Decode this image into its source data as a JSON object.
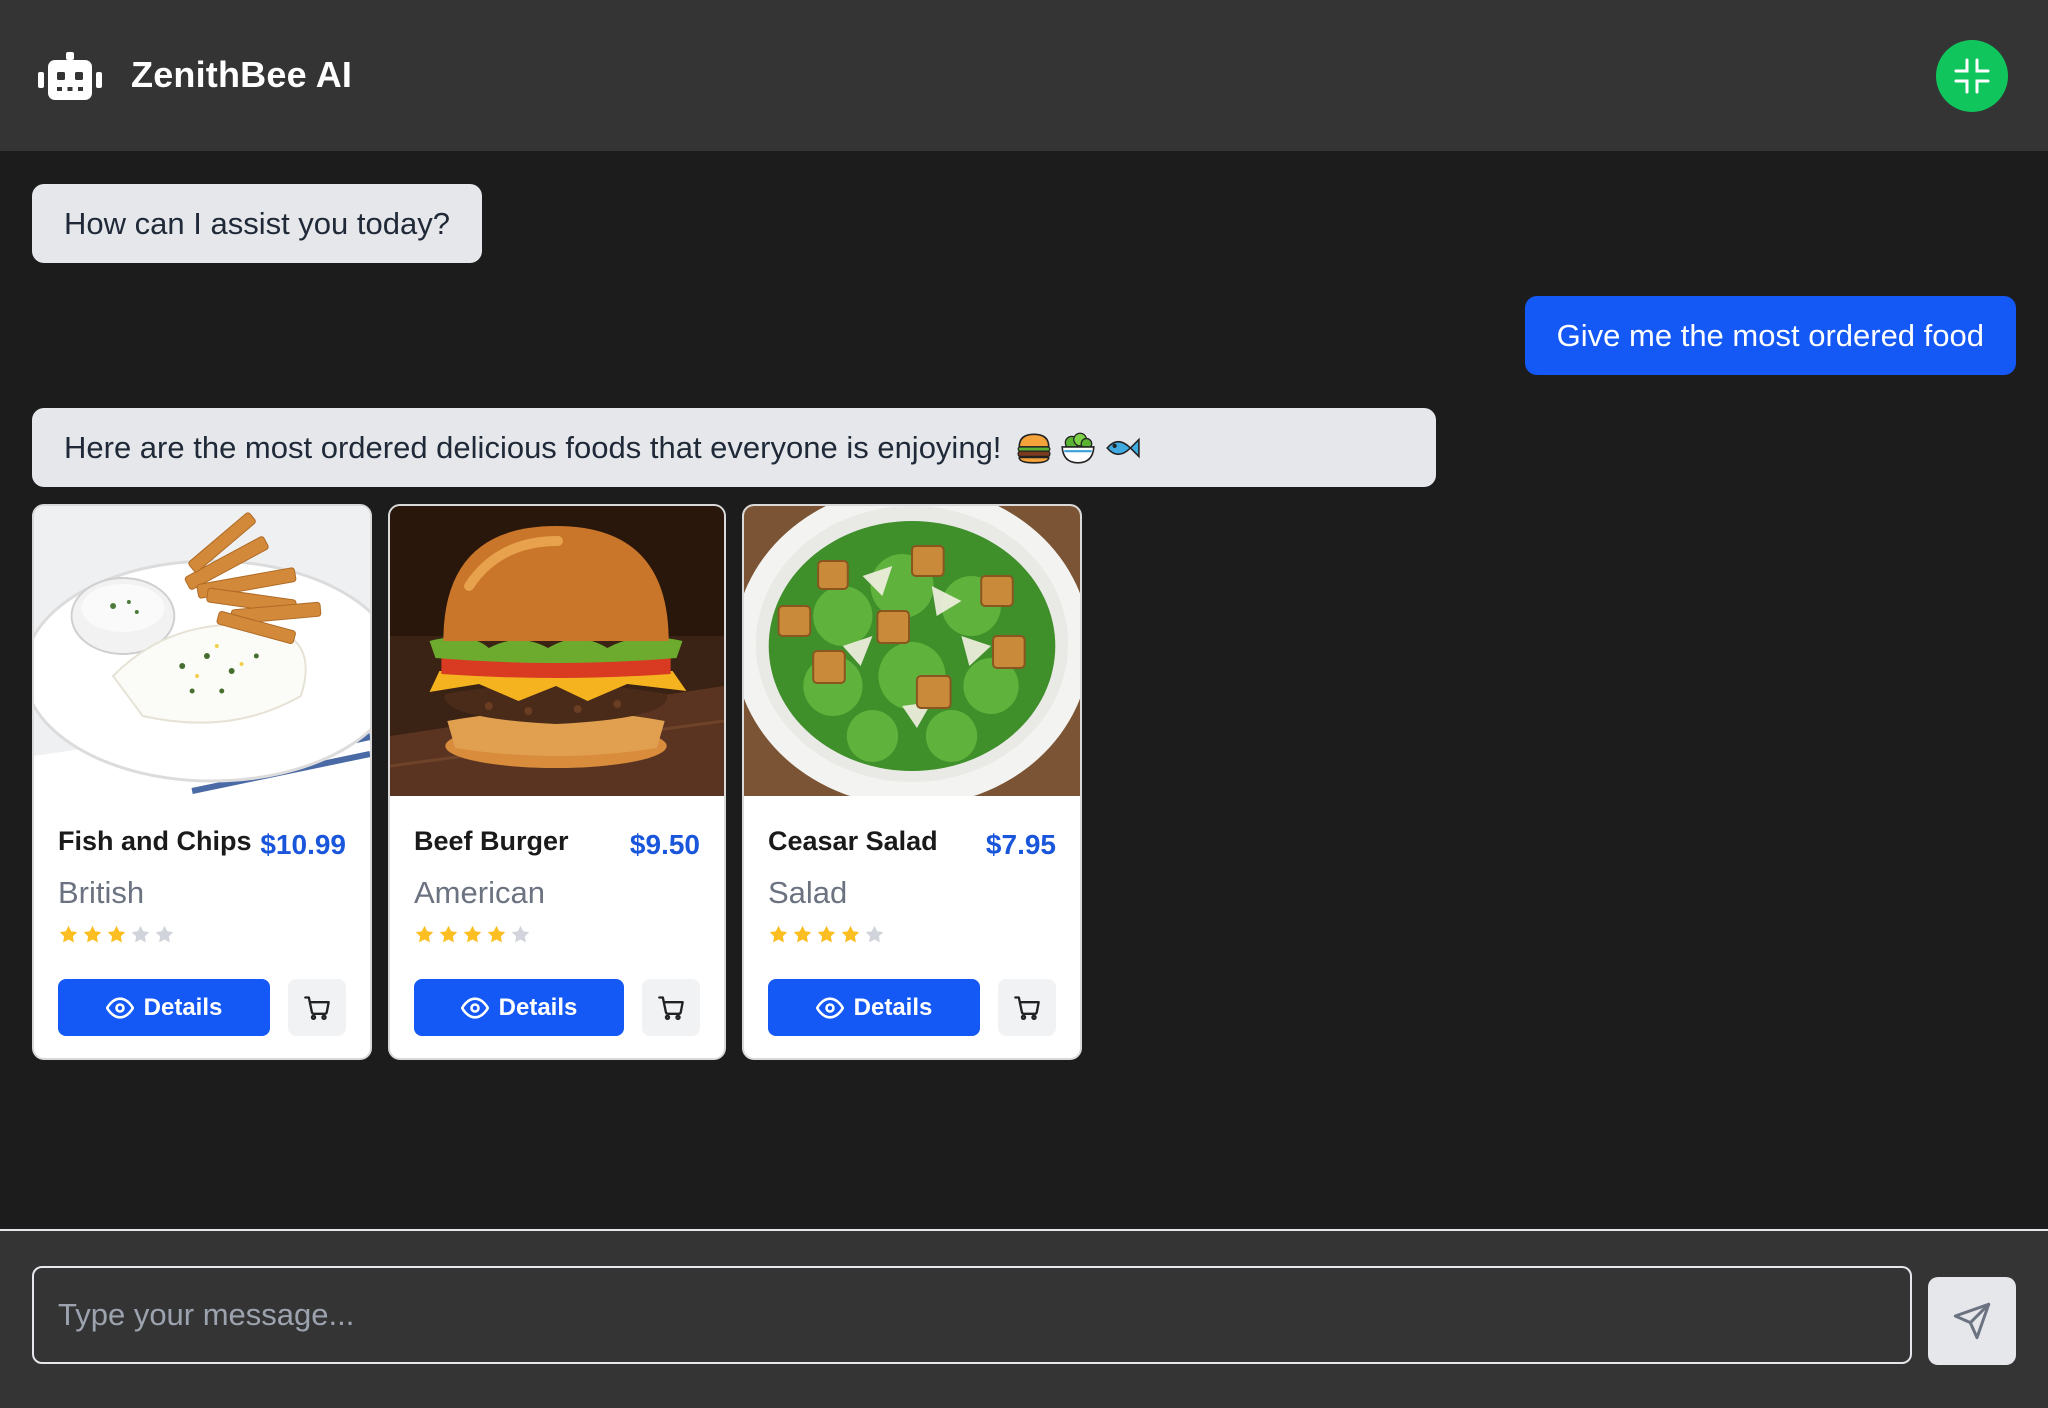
{
  "header": {
    "title": "ZenithBee AI",
    "icons": {
      "logo": "robot-icon",
      "minimize": "minimize-icon"
    },
    "minimize_color": "#10c55c"
  },
  "messages": [
    {
      "role": "bot",
      "text": "How can I assist you today?"
    },
    {
      "role": "user",
      "text": "Give me the most ordered food"
    },
    {
      "role": "bot",
      "text": "Here are the most ordered delicious foods that everyone is enjoying!",
      "emojis": [
        "hamburger-emoji",
        "salad-emoji",
        "fish-emoji"
      ]
    }
  ],
  "foods": [
    {
      "name": "Fish and Chips",
      "price": "$10.99",
      "cuisine": "British",
      "rating": 3,
      "details_label": "Details"
    },
    {
      "name": "Beef Burger",
      "price": "$9.50",
      "cuisine": "American",
      "rating": 4,
      "details_label": "Details"
    },
    {
      "name": "Ceasar Salad",
      "price": "$7.95",
      "cuisine": "Salad",
      "rating": 4,
      "details_label": "Details"
    }
  ],
  "input": {
    "placeholder": "Type your message...",
    "value": ""
  },
  "colors": {
    "accent": "#1458f5",
    "price": "#1a56db",
    "star_on": "#fbbf24",
    "star_off": "#d1d5db"
  }
}
